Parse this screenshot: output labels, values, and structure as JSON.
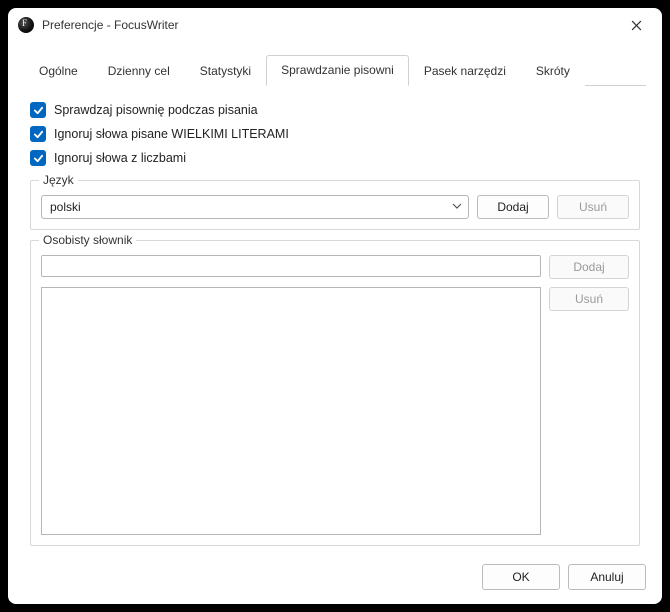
{
  "window": {
    "title": "Preferencje - FocusWriter"
  },
  "tabs": {
    "items": [
      {
        "label": "Ogólne"
      },
      {
        "label": "Dzienny cel"
      },
      {
        "label": "Statystyki"
      },
      {
        "label": "Sprawdzanie pisowni"
      },
      {
        "label": "Pasek narzędzi"
      },
      {
        "label": "Skróty"
      }
    ],
    "activeIndex": 3
  },
  "spellcheck": {
    "check1": "Sprawdzaj pisownię podczas pisania",
    "check2": "Ignoruj słowa pisane WIELKIMI LITERAMI",
    "check3": "Ignoruj słowa z liczbami",
    "language_legend": "Język",
    "language_value": "polski",
    "add_label": "Dodaj",
    "remove_label": "Usuń",
    "dict_legend": "Osobisty słownik",
    "dict_input": "",
    "dict_add_label": "Dodaj",
    "dict_remove_label": "Usuń"
  },
  "footer": {
    "ok": "OK",
    "cancel": "Anuluj"
  }
}
